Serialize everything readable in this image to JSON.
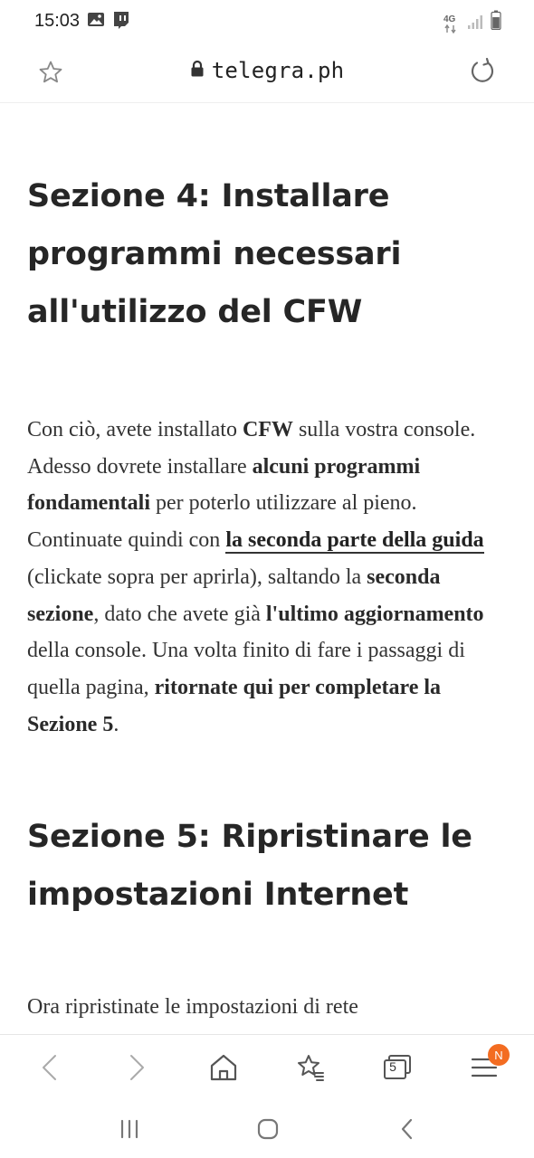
{
  "status_bar": {
    "time": "15:03",
    "left_icons": [
      "gallery-icon",
      "twitch-icon"
    ],
    "network": "4G",
    "right_icons": [
      "4g-data-icon",
      "signal-icon",
      "battery-icon"
    ]
  },
  "address_bar": {
    "domain": "telegra.ph",
    "icons": [
      "star-icon",
      "lock-icon",
      "reload-icon"
    ]
  },
  "article": {
    "heading_1": "Sezione 4: Installare programmi necessari all'utilizzo del CFW",
    "paragraph": {
      "t1": "Con ciò, avete installato ",
      "b1": "CFW",
      "t2": " sulla vostra console. Adesso dovrete installare ",
      "b2": "alcuni programmi fondamentali",
      "t3": " per poterlo utilizzare al pieno. Continuate quindi con ",
      "link": "la seconda parte della guida",
      "t4": " (clickate sopra per aprirla), saltando la ",
      "b3": "seconda sezione",
      "t5": ", dato che avete già ",
      "b4": "l'ultimo aggiornamento",
      "t6": " della console. Una volta finito di fare i passaggi di quella pagina, ",
      "b5": "ritornate qui per completare la Sezione 5",
      "t7": "."
    },
    "heading_2": "Sezione 5: Ripristinare le impostazioni Internet",
    "partial_line": "Ora ripristinate le impostazioni di rete"
  },
  "bottom_toolbar": {
    "tab_count": "5",
    "menu_badge": "N",
    "badge_color": "#f36c21",
    "icons": [
      "back-icon",
      "forward-icon",
      "home-icon",
      "bookmarks-icon",
      "tabs-icon",
      "menu-icon"
    ]
  },
  "nav_bar": {
    "icons": [
      "recent-apps-icon",
      "home-nav-icon",
      "back-nav-icon"
    ]
  }
}
